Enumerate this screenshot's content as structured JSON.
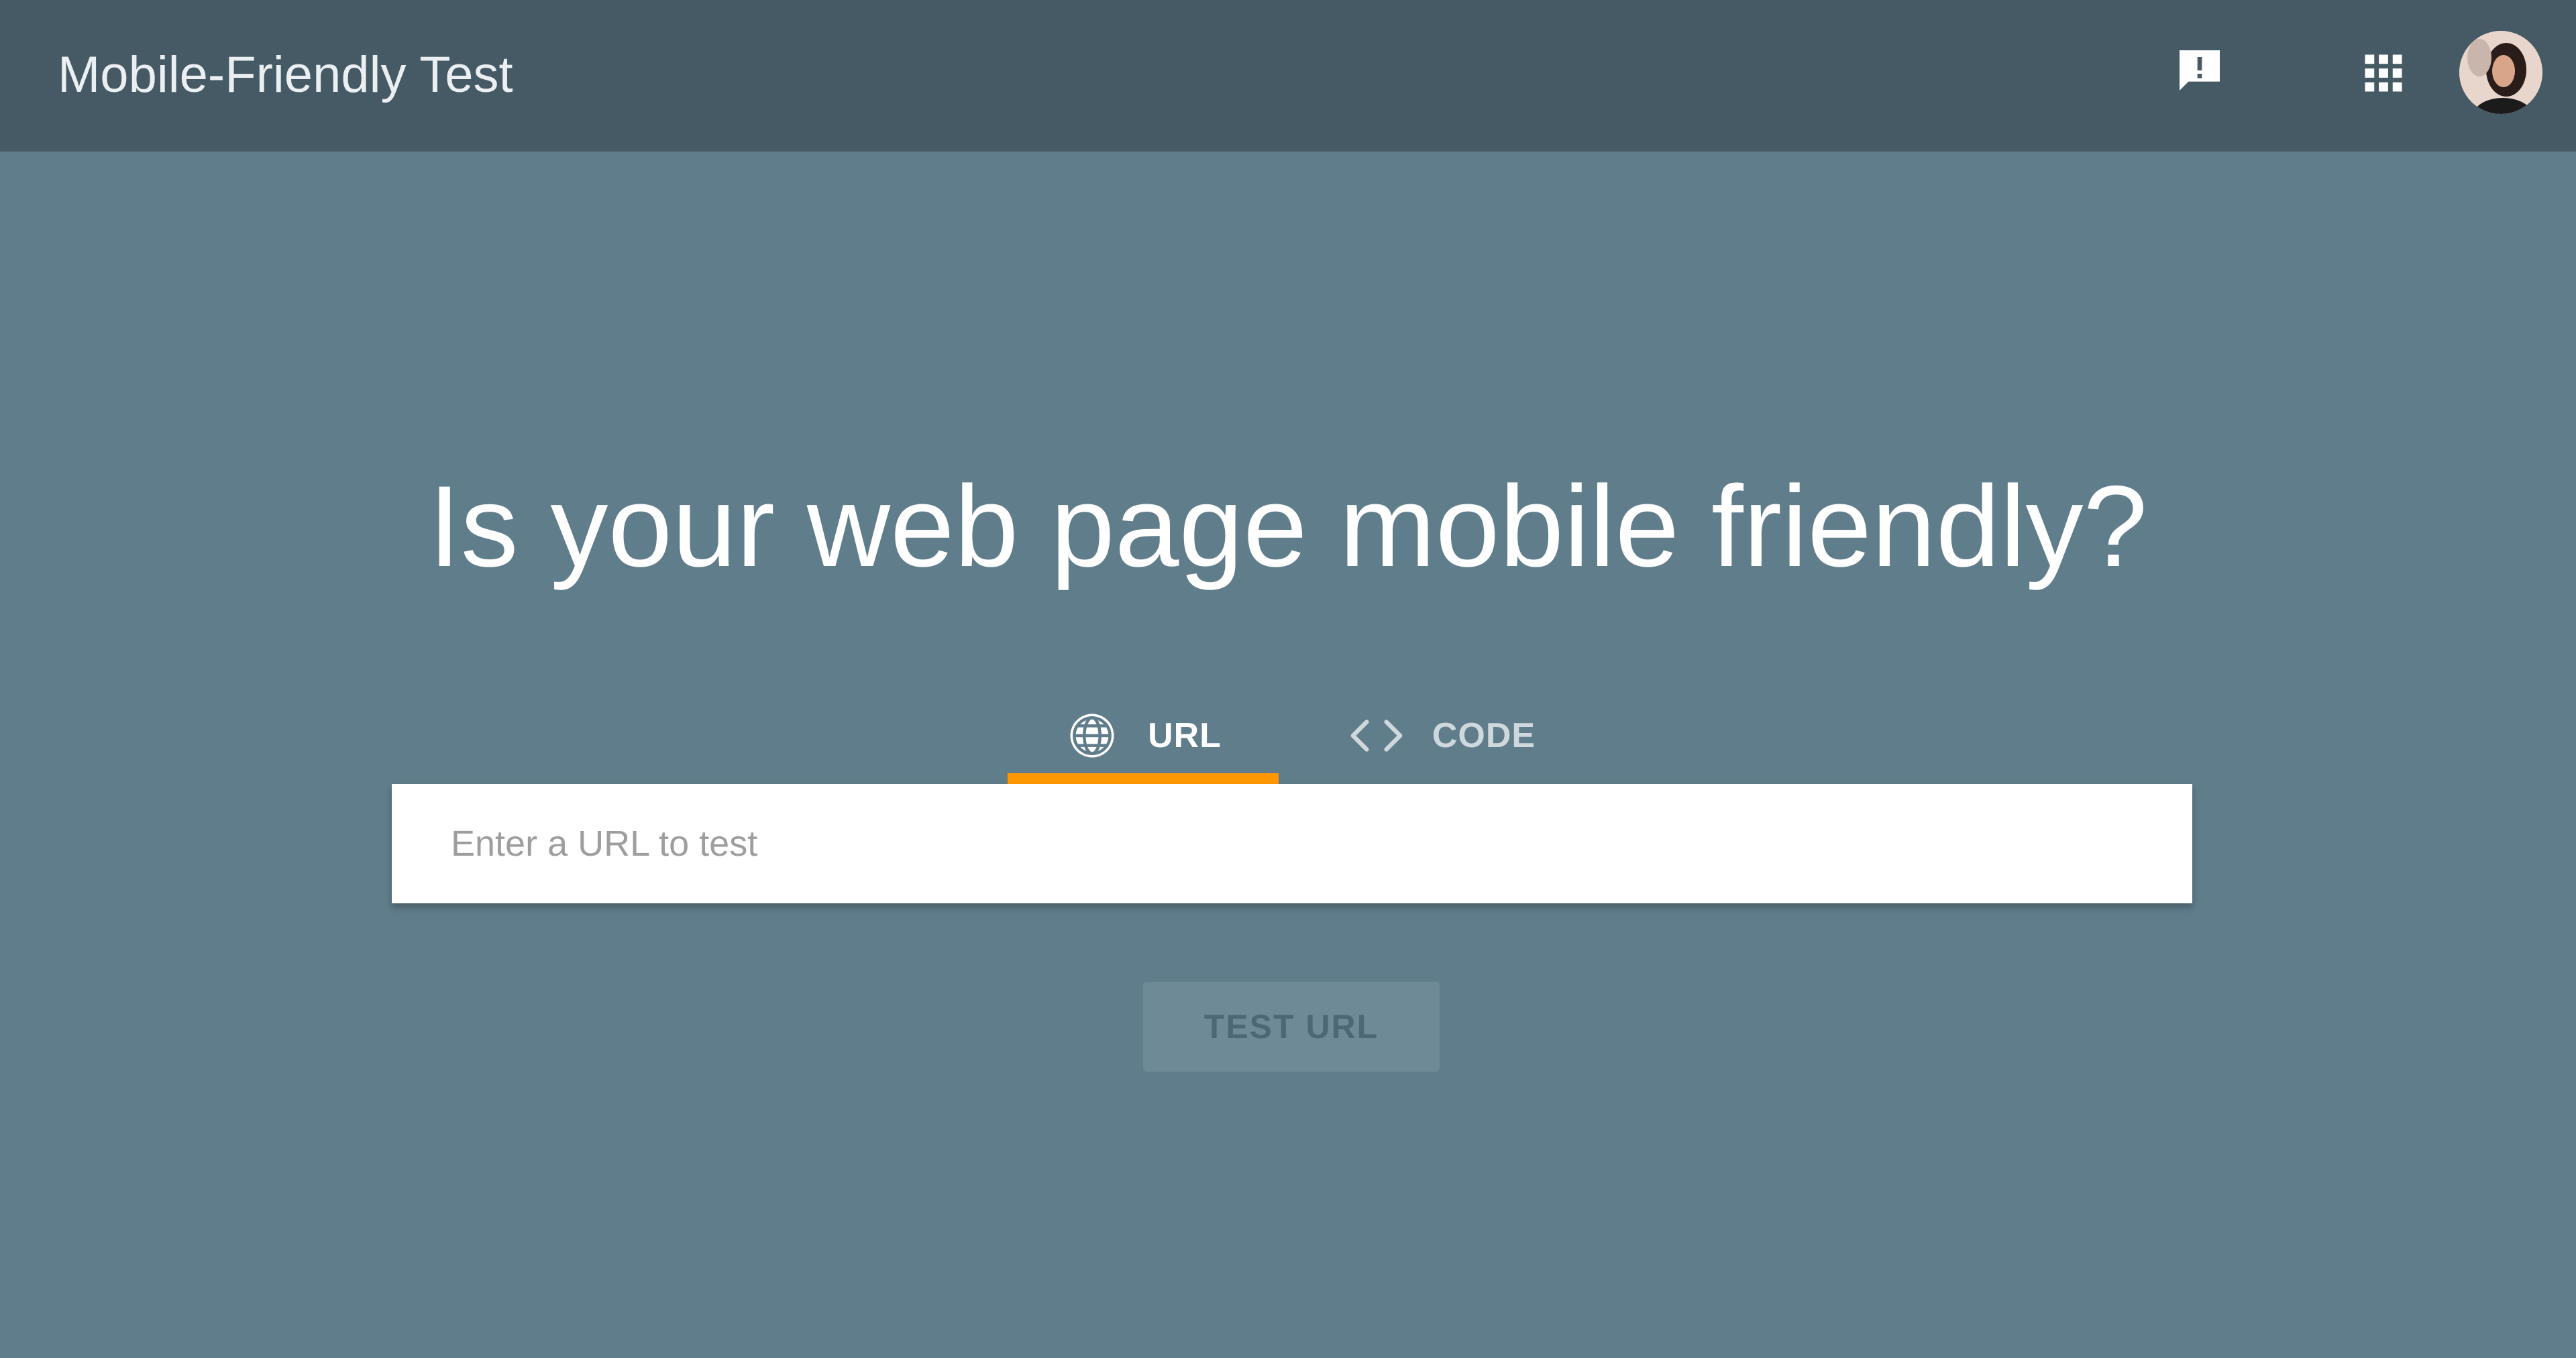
{
  "header": {
    "title": "Mobile-Friendly Test",
    "icons": {
      "feedback": "feedback-icon",
      "apps": "apps-grid-icon",
      "account": "avatar"
    }
  },
  "main": {
    "headline": "Is your web page mobile friendly?",
    "tabs": [
      {
        "label": "URL",
        "icon": "globe-icon",
        "selected": true
      },
      {
        "label": "CODE",
        "icon": "code-brackets-icon",
        "selected": false
      }
    ],
    "url_input": {
      "placeholder": "Enter a URL to test",
      "value": ""
    },
    "test_button": {
      "label": "TEST URL",
      "enabled": false
    }
  },
  "colors": {
    "background": "#607D8B",
    "topbar": "#455A64",
    "tab_indicator": "#FF9800",
    "input_background": "#FFFFFF"
  }
}
